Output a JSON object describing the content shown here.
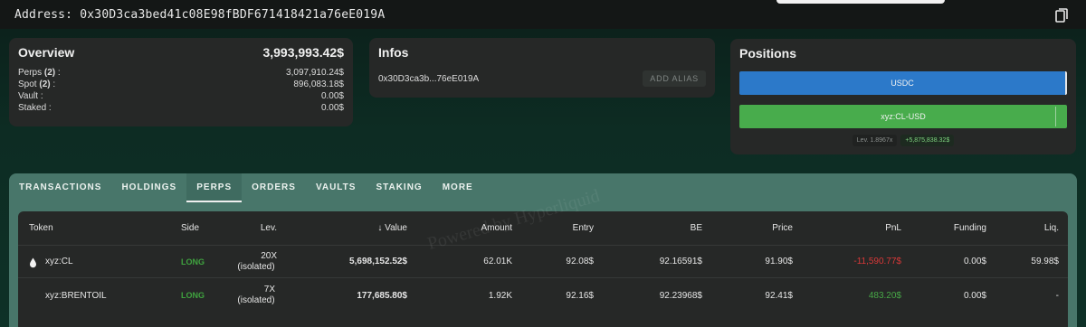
{
  "address": {
    "label": "Address: 0x30D3ca3bed41c08E98fBDF671418421a76eE019A",
    "icon": "copy-icon"
  },
  "overview": {
    "title": "Overview",
    "total": "3,993,993.42$",
    "rows": [
      {
        "label": "Perps",
        "count": "(2)",
        "suffix": " :",
        "value": "3,097,910.24$"
      },
      {
        "label": "Spot",
        "count": "(2)",
        "suffix": " :",
        "value": "896,083.18$"
      },
      {
        "label": "Vault",
        "count": "",
        "suffix": " :",
        "value": "0.00$"
      },
      {
        "label": "Staked",
        "count": "",
        "suffix": " :",
        "value": "0.00$"
      }
    ]
  },
  "infos": {
    "title": "Infos",
    "address": "0x30D3ca3b...76eE019A",
    "alias_button": "ADD ALIAS"
  },
  "positions": {
    "title": "Positions",
    "bars": [
      {
        "label": "USDC",
        "color": "#2c79c9"
      },
      {
        "label": "xyz:CL-USD",
        "color": "#48ac4c"
      }
    ],
    "lev_tag": "Lev. 1.8967x",
    "pnl_tag": "+5,875,838.32$"
  },
  "tabs": [
    "TRANSACTIONS",
    "HOLDINGS",
    "PERPS",
    "ORDERS",
    "VAULTS",
    "STAKING",
    "MORE"
  ],
  "active_tab": "PERPS",
  "table": {
    "headers": {
      "token": "Token",
      "side": "Side",
      "lev": "Lev.",
      "value_arrow": "↓",
      "value": "Value",
      "amount": "Amount",
      "entry": "Entry",
      "be": "BE",
      "price": "Price",
      "pnl": "PnL",
      "funding": "Funding",
      "liq": "Liq."
    },
    "rows": [
      {
        "token": "xyz:CL",
        "side": "LONG",
        "lev1": "20X",
        "lev2": "(isolated)",
        "value": "5,698,152.52$",
        "amount": "62.01K",
        "entry": "92.08$",
        "be": "92.16591$",
        "price": "91.90$",
        "pnl": "-11,590.77$",
        "funding": "0.00$",
        "liq": "59.98$",
        "icon": "drop-icon"
      },
      {
        "token": "xyz:BRENTOIL",
        "side": "LONG",
        "lev1": "7X",
        "lev2": "(isolated)",
        "value": "177,685.80$",
        "amount": "1.92K",
        "entry": "92.16$",
        "be": "92.23968$",
        "price": "92.41$",
        "pnl": "483.20$",
        "funding": "0.00$",
        "liq": "-"
      }
    ]
  },
  "watermark": "Powered by Hyperliquid"
}
